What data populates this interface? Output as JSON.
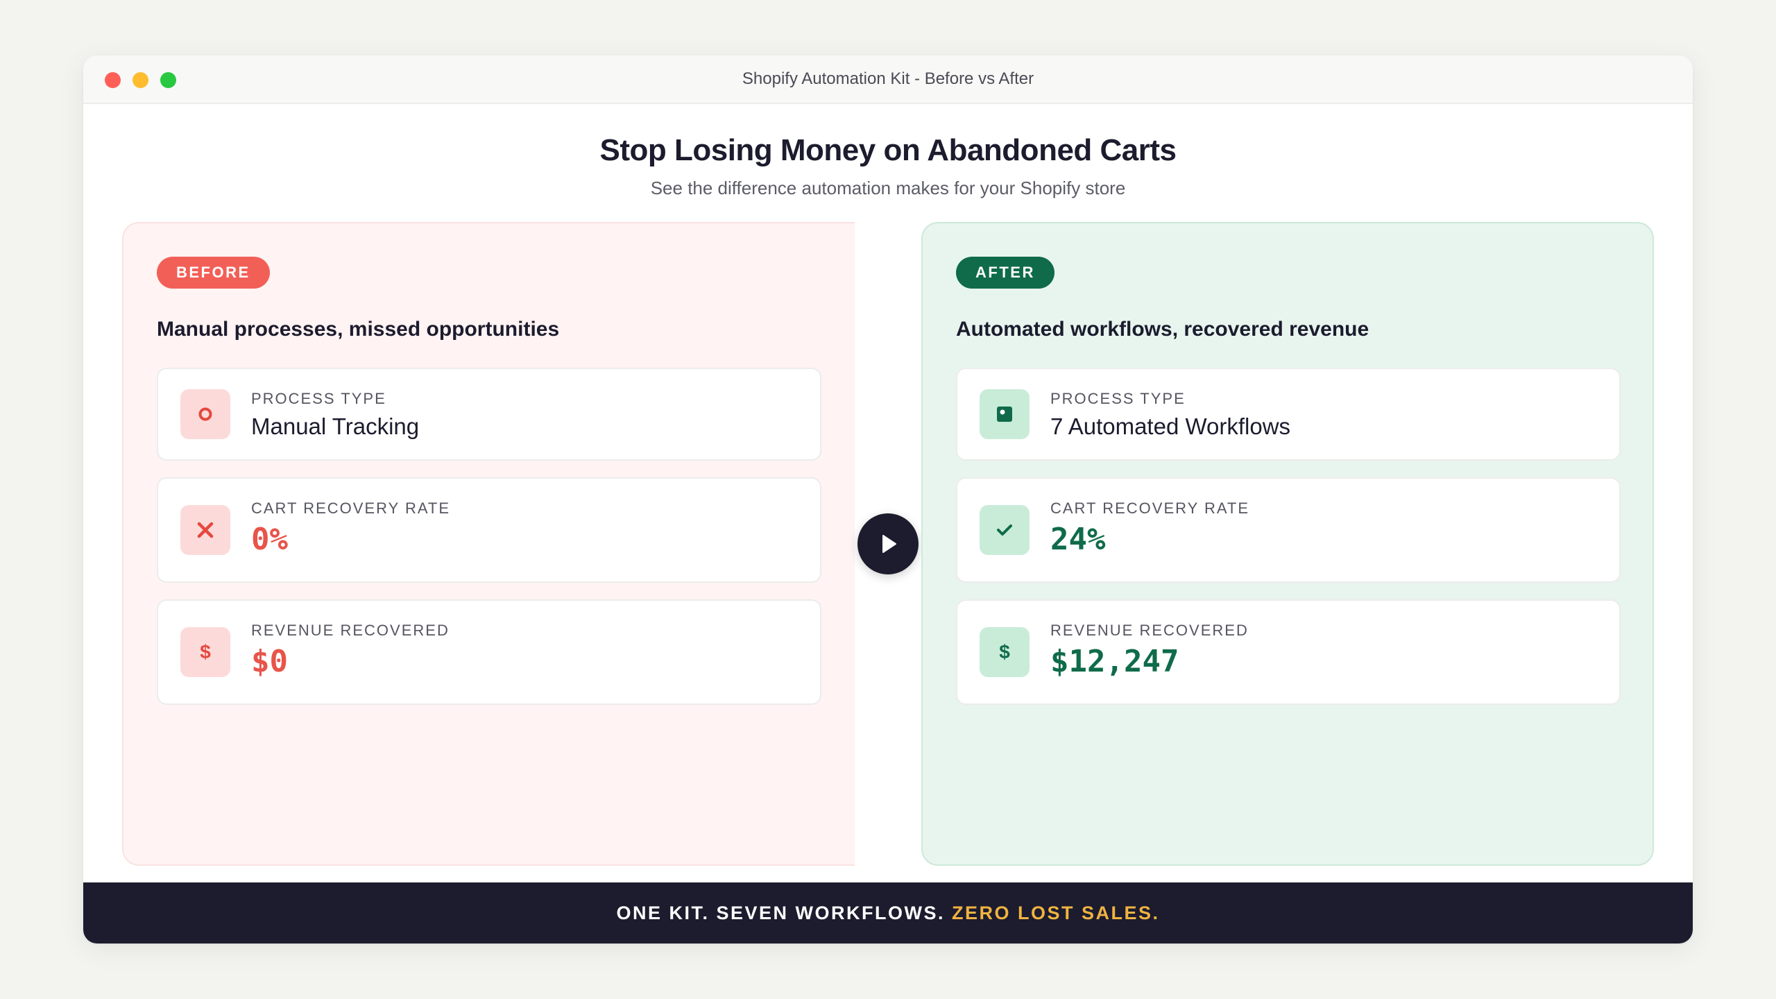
{
  "window": {
    "title": "Shopify Automation Kit - Before vs After"
  },
  "header": {
    "title": "Stop Losing Money on Abandoned Carts",
    "subtitle": "See the difference automation makes for your Shopify store"
  },
  "before": {
    "badge": "BEFORE",
    "heading": "Manual processes, missed opportunities",
    "cards": [
      {
        "label": "PROCESS TYPE",
        "value": "Manual Tracking",
        "icon": "circle-icon"
      },
      {
        "label": "CART RECOVERY RATE",
        "value": "0%",
        "icon": "x-icon"
      },
      {
        "label": "REVENUE RECOVERED",
        "value": "$0",
        "icon": "dollar-icon",
        "icon_glyph": "$"
      }
    ]
  },
  "after": {
    "badge": "AFTER",
    "heading": "Automated workflows, recovered revenue",
    "cards": [
      {
        "label": "PROCESS TYPE",
        "value": "7 Automated Workflows",
        "icon": "workflow-icon"
      },
      {
        "label": "CART RECOVERY RATE",
        "value": "24%",
        "icon": "check-icon"
      },
      {
        "label": "REVENUE RECOVERED",
        "value": "$12,247",
        "icon": "dollar-icon",
        "icon_glyph": "$"
      }
    ]
  },
  "footer": {
    "text": "ONE KIT. SEVEN WORKFLOWS.",
    "accent": "ZERO LOST SALES."
  },
  "colors": {
    "before_accent": "#f25f57",
    "after_accent": "#0f6b4a",
    "footer_bg": "#1c1c2e",
    "footer_accent": "#f0b341"
  }
}
